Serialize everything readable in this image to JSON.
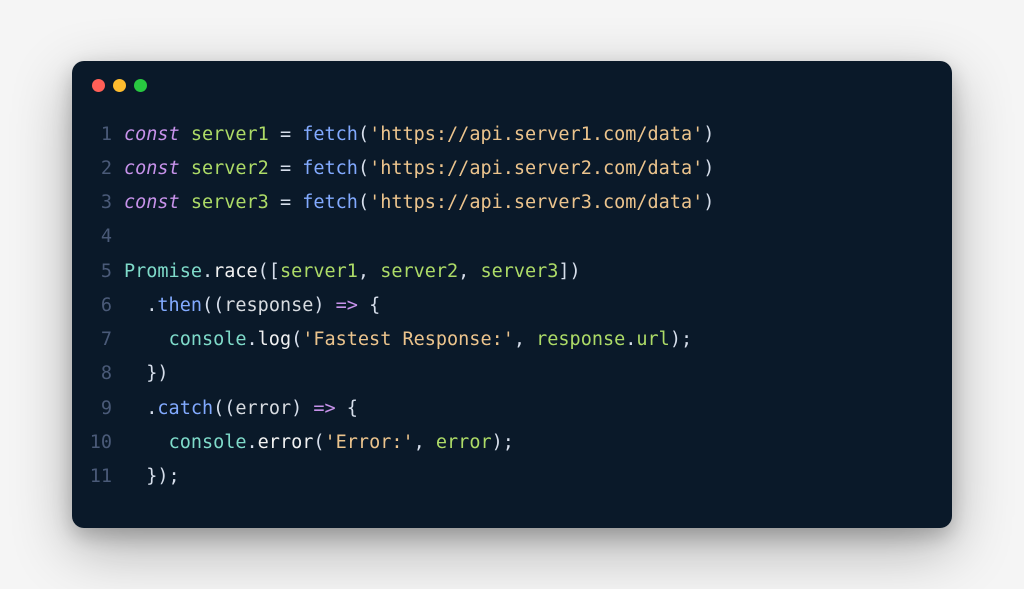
{
  "titlebar": {
    "dots": [
      "red",
      "yellow",
      "green"
    ]
  },
  "code": {
    "lines": [
      {
        "num": "1",
        "tokens": [
          {
            "cls": "kw",
            "t": "const"
          },
          {
            "cls": "plain",
            "t": " "
          },
          {
            "cls": "var",
            "t": "server1"
          },
          {
            "cls": "plain",
            "t": " "
          },
          {
            "cls": "punct",
            "t": "="
          },
          {
            "cls": "plain",
            "t": " "
          },
          {
            "cls": "fn",
            "t": "fetch"
          },
          {
            "cls": "punct",
            "t": "("
          },
          {
            "cls": "str",
            "t": "'https://api.server1.com/data'"
          },
          {
            "cls": "punct",
            "t": ")"
          }
        ]
      },
      {
        "num": "2",
        "tokens": [
          {
            "cls": "kw",
            "t": "const"
          },
          {
            "cls": "plain",
            "t": " "
          },
          {
            "cls": "var",
            "t": "server2"
          },
          {
            "cls": "plain",
            "t": " "
          },
          {
            "cls": "punct",
            "t": "="
          },
          {
            "cls": "plain",
            "t": " "
          },
          {
            "cls": "fn",
            "t": "fetch"
          },
          {
            "cls": "punct",
            "t": "("
          },
          {
            "cls": "str",
            "t": "'https://api.server2.com/data'"
          },
          {
            "cls": "punct",
            "t": ")"
          }
        ]
      },
      {
        "num": "3",
        "tokens": [
          {
            "cls": "kw",
            "t": "const"
          },
          {
            "cls": "plain",
            "t": " "
          },
          {
            "cls": "var",
            "t": "server3"
          },
          {
            "cls": "plain",
            "t": " "
          },
          {
            "cls": "punct",
            "t": "="
          },
          {
            "cls": "plain",
            "t": " "
          },
          {
            "cls": "fn",
            "t": "fetch"
          },
          {
            "cls": "punct",
            "t": "("
          },
          {
            "cls": "str",
            "t": "'https://api.server3.com/data'"
          },
          {
            "cls": "punct",
            "t": ")"
          }
        ]
      },
      {
        "num": "4",
        "tokens": []
      },
      {
        "num": "5",
        "tokens": [
          {
            "cls": "obj",
            "t": "Promise"
          },
          {
            "cls": "punct",
            "t": "."
          },
          {
            "cls": "methodw",
            "t": "race"
          },
          {
            "cls": "punct",
            "t": "(["
          },
          {
            "cls": "var",
            "t": "server1"
          },
          {
            "cls": "punct",
            "t": ", "
          },
          {
            "cls": "var",
            "t": "server2"
          },
          {
            "cls": "punct",
            "t": ", "
          },
          {
            "cls": "var",
            "t": "server3"
          },
          {
            "cls": "punct",
            "t": "])"
          }
        ]
      },
      {
        "num": "6",
        "tokens": [
          {
            "cls": "plain",
            "t": "  "
          },
          {
            "cls": "punct",
            "t": "."
          },
          {
            "cls": "method",
            "t": "then"
          },
          {
            "cls": "punct",
            "t": "(("
          },
          {
            "cls": "param",
            "t": "response"
          },
          {
            "cls": "punct",
            "t": ") "
          },
          {
            "cls": "arrow",
            "t": "=>"
          },
          {
            "cls": "punct",
            "t": " {"
          }
        ]
      },
      {
        "num": "7",
        "tokens": [
          {
            "cls": "plain",
            "t": "    "
          },
          {
            "cls": "obj",
            "t": "console"
          },
          {
            "cls": "punct",
            "t": "."
          },
          {
            "cls": "methodw",
            "t": "log"
          },
          {
            "cls": "punct",
            "t": "("
          },
          {
            "cls": "str",
            "t": "'Fastest Response:'"
          },
          {
            "cls": "punct",
            "t": ", "
          },
          {
            "cls": "var",
            "t": "response"
          },
          {
            "cls": "punct",
            "t": "."
          },
          {
            "cls": "prop",
            "t": "url"
          },
          {
            "cls": "punct",
            "t": ");"
          }
        ]
      },
      {
        "num": "8",
        "tokens": [
          {
            "cls": "plain",
            "t": "  "
          },
          {
            "cls": "punct",
            "t": "})"
          }
        ]
      },
      {
        "num": "9",
        "tokens": [
          {
            "cls": "plain",
            "t": "  "
          },
          {
            "cls": "punct",
            "t": "."
          },
          {
            "cls": "method",
            "t": "catch"
          },
          {
            "cls": "punct",
            "t": "(("
          },
          {
            "cls": "param",
            "t": "error"
          },
          {
            "cls": "punct",
            "t": ") "
          },
          {
            "cls": "arrow",
            "t": "=>"
          },
          {
            "cls": "punct",
            "t": " {"
          }
        ]
      },
      {
        "num": "10",
        "tokens": [
          {
            "cls": "plain",
            "t": "    "
          },
          {
            "cls": "obj",
            "t": "console"
          },
          {
            "cls": "punct",
            "t": "."
          },
          {
            "cls": "methodw",
            "t": "error"
          },
          {
            "cls": "punct",
            "t": "("
          },
          {
            "cls": "str",
            "t": "'Error:'"
          },
          {
            "cls": "punct",
            "t": ", "
          },
          {
            "cls": "var",
            "t": "error"
          },
          {
            "cls": "punct",
            "t": ");"
          }
        ]
      },
      {
        "num": "11",
        "tokens": [
          {
            "cls": "plain",
            "t": "  "
          },
          {
            "cls": "punct",
            "t": "});"
          }
        ]
      }
    ]
  }
}
